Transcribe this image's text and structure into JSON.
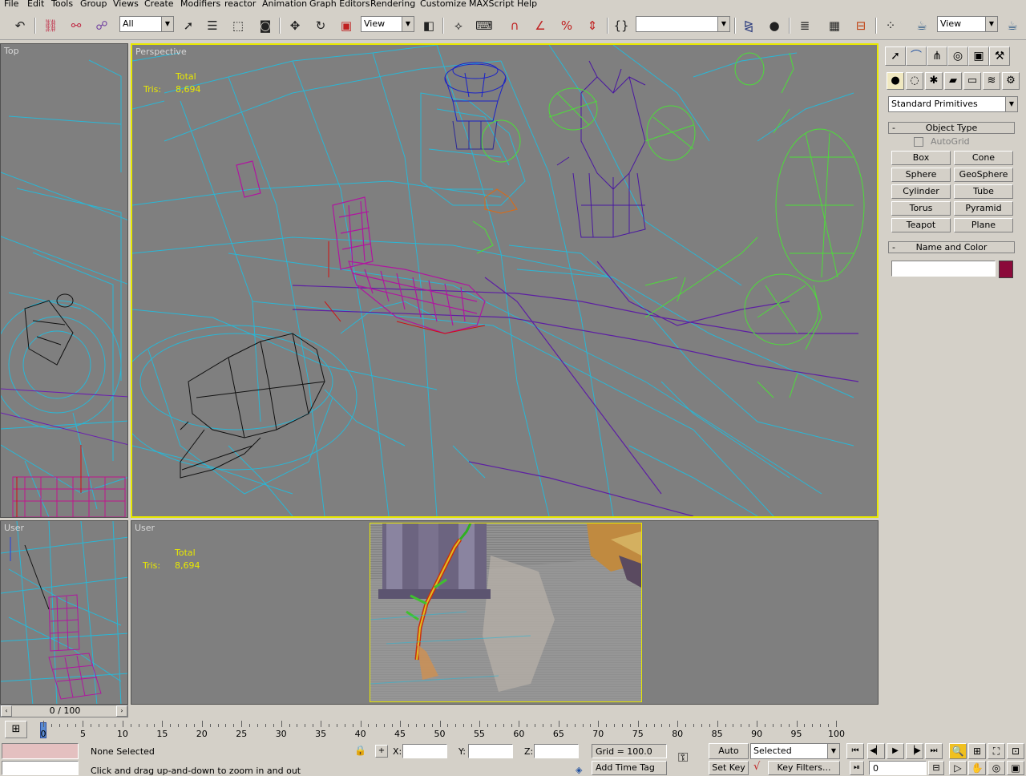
{
  "menu": [
    "File",
    "Edit",
    "Tools",
    "Group",
    "Views",
    "Create",
    "Modifiers",
    "reactor",
    "Animation",
    "Graph Editors",
    "Rendering",
    "Customize",
    "MAXScript",
    "Help"
  ],
  "toolbar": {
    "selection_filter": "All",
    "ref_coord": "View",
    "named_selection": "",
    "render_type": "View",
    "icons": [
      "undo-icon",
      "select-link-icon",
      "unlink-icon",
      "bind-spacewarp-icon",
      "select-object-icon",
      "select-by-name-icon",
      "rect-region-icon",
      "window-crossing-icon",
      "move-icon",
      "rotate-icon",
      "scale-icon",
      "pivot-center-icon",
      "manipulate-icon",
      "keyboard-shortcut-icon",
      "snap-3d-icon",
      "angle-snap-icon",
      "percent-snap-icon",
      "spinner-snap-icon",
      "edit-named-selection-icon",
      "mirror-icon",
      "align-icon",
      "layer-manager-icon",
      "curve-editor-icon",
      "schematic-view-icon",
      "material-editor-icon",
      "render-scene-icon",
      "quick-render-icon"
    ]
  },
  "viewports": {
    "top": {
      "label": "Top"
    },
    "perspective": {
      "label": "Perspective",
      "stats_total": "Total",
      "stats_tris_label": "Tris:",
      "stats_tris_value": "8,694"
    },
    "user_left": {
      "label": "User"
    },
    "user_main": {
      "label": "User",
      "stats_total": "Total",
      "stats_tris_label": "Tris:",
      "stats_tris_value": "8,694"
    }
  },
  "command_panel": {
    "tabs": [
      "create-tab-icon",
      "modify-tab-icon",
      "hierarchy-tab-icon",
      "motion-tab-icon",
      "display-tab-icon",
      "utilities-tab-icon"
    ],
    "subcategories": [
      "geometry-icon",
      "shapes-icon",
      "lights-icon",
      "cameras-icon",
      "helpers-icon",
      "spacewarps-icon",
      "systems-icon"
    ],
    "category_dropdown": "Standard Primitives",
    "object_type_title": "Object Type",
    "autogrid_label": "AutoGrid",
    "buttons": [
      "Box",
      "Cone",
      "Sphere",
      "GeoSphere",
      "Cylinder",
      "Tube",
      "Torus",
      "Pyramid",
      "Teapot",
      "Plane"
    ],
    "name_color_title": "Name and Color",
    "object_name": "",
    "object_color": "#8b0a3a"
  },
  "timeline": {
    "frame_counter": "0 / 100",
    "ticks": [
      "0",
      "5",
      "10",
      "15",
      "20",
      "25",
      "30",
      "35",
      "40",
      "45",
      "50",
      "55",
      "60",
      "65",
      "70",
      "75",
      "80",
      "85",
      "90",
      "95",
      "100"
    ]
  },
  "status": {
    "selection": "None Selected",
    "prompt": "Click and drag up-and-down to zoom in and out",
    "x_label": "X:",
    "y_label": "Y:",
    "z_label": "Z:",
    "x_value": "",
    "y_value": "",
    "z_value": "",
    "grid": "Grid = 100.0",
    "add_time_tag": "Add Time Tag",
    "auto_key": "Auto Key",
    "set_key": "Set Key",
    "key_mode": "Selected",
    "key_filters": "Key Filters...",
    "current_frame": "0"
  }
}
